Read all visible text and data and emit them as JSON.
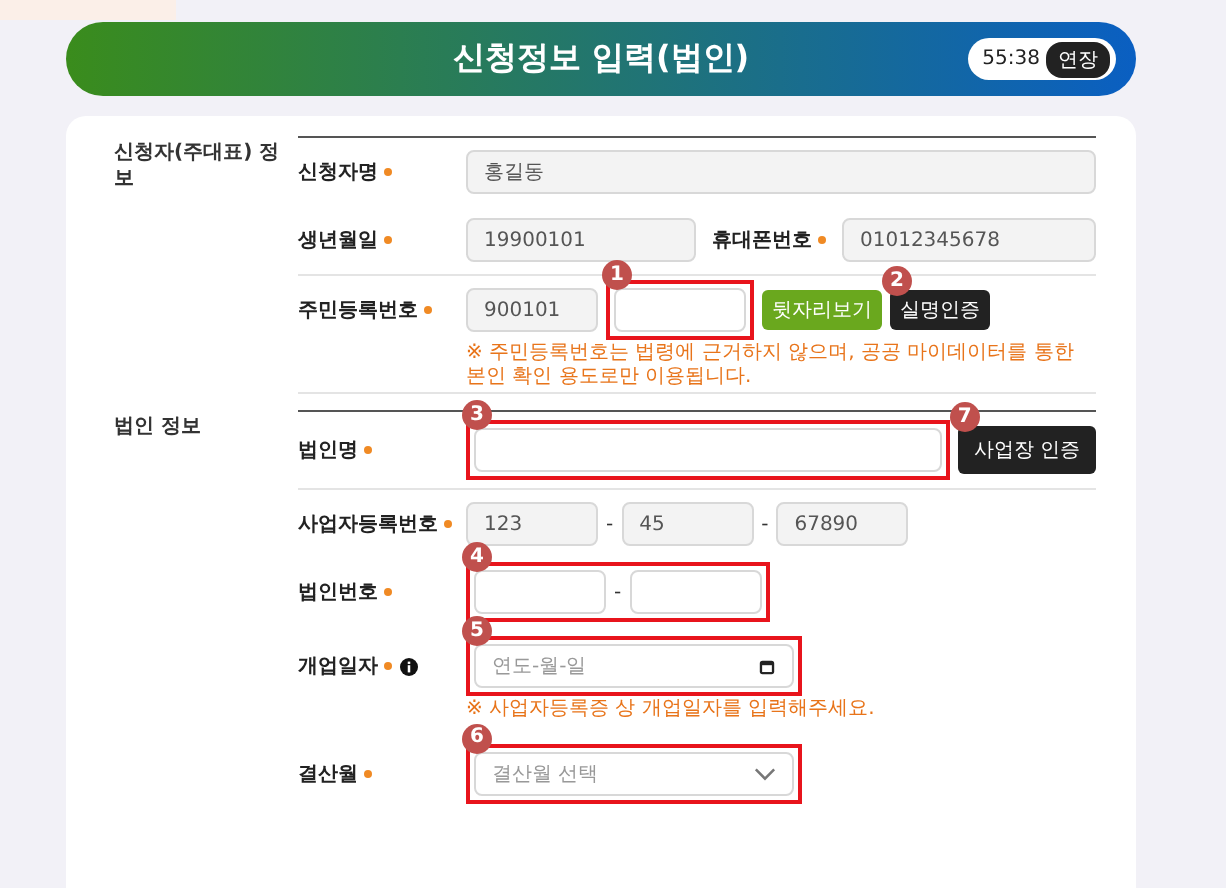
{
  "header": {
    "title": "신청정보 입력(법인)",
    "timer": "55:38",
    "extend_button": "연장"
  },
  "sections": [
    {
      "title": "신청자(주대표) 정보",
      "rows": [
        {
          "kind": "text",
          "label": "신청자명",
          "required": true,
          "controls": [
            {
              "kind": "input",
              "value": "홍길동",
              "readonly": true
            }
          ]
        },
        {
          "kind": "pair",
          "label": "생년월일",
          "required": true,
          "controls": [
            {
              "kind": "input",
              "value": "19900101",
              "readonly": true
            },
            {
              "kind": "label",
              "text": "휴대폰번호",
              "required": true
            },
            {
              "kind": "input",
              "value": "01012345678",
              "readonly": true
            }
          ]
        },
        {
          "kind": "split",
          "label": "주민등록번호",
          "required": true,
          "controls": [
            {
              "kind": "input",
              "value": "900101",
              "readonly": true
            },
            {
              "kind": "input",
              "readonly": false,
              "callout": {
                "number": "1",
                "kind": "frame"
              }
            },
            {
              "kind": "button",
              "label": "뒷자리보기",
              "color": "#6aa81e"
            },
            {
              "kind": "button",
              "label": "실명인증",
              "color": "#222222",
              "callout": {
                "number": "2",
                "kind": "badge"
              }
            }
          ],
          "note": "※ 주민등록번호는 법령에 근거하지 않으며, 공공 마이데이터를 통한 본인 확인 용도로만 이용됩니다."
        }
      ]
    },
    {
      "title": "법인 정보",
      "rows": [
        {
          "kind": "text",
          "label": "법인명",
          "required": true,
          "controls": [
            {
              "kind": "input",
              "readonly": false,
              "callout": {
                "number": "3",
                "kind": "frame"
              }
            },
            {
              "kind": "button",
              "label": "사업장 인증",
              "color": "#222222",
              "callout": {
                "number": "7",
                "kind": "badge"
              }
            }
          ]
        },
        {
          "kind": "split",
          "label": "사업자등록번호",
          "required": true,
          "controls": [
            {
              "kind": "input",
              "value": "123",
              "readonly": true
            },
            {
              "kind": "sep",
              "text": "-"
            },
            {
              "kind": "input",
              "value": "45",
              "readonly": true
            },
            {
              "kind": "sep",
              "text": "-"
            },
            {
              "kind": "input",
              "value": "67890",
              "readonly": true
            }
          ]
        },
        {
          "kind": "split",
          "label": "법인번호",
          "required": true,
          "controls": [
            {
              "kind": "group",
              "callout": {
                "number": "4",
                "kind": "frame"
              },
              "controls": [
                {
                  "kind": "input",
                  "readonly": false
                },
                {
                  "kind": "sep",
                  "text": "-"
                },
                {
                  "kind": "input",
                  "readonly": false
                }
              ]
            }
          ]
        },
        {
          "kind": "date",
          "label": "개업일자",
          "required": true,
          "info": true,
          "controls": [
            {
              "kind": "date",
              "placeholder": "연도-월-일",
              "callout": {
                "number": "5",
                "kind": "frame"
              }
            }
          ],
          "note": "※ 사업자등록증 상 개업일자를 입력해주세요."
        },
        {
          "kind": "select",
          "label": "결산월",
          "required": true,
          "controls": [
            {
              "kind": "select",
              "placeholder": "결산월 선택",
              "callout": {
                "number": "6",
                "kind": "frame"
              }
            }
          ]
        }
      ]
    }
  ]
}
